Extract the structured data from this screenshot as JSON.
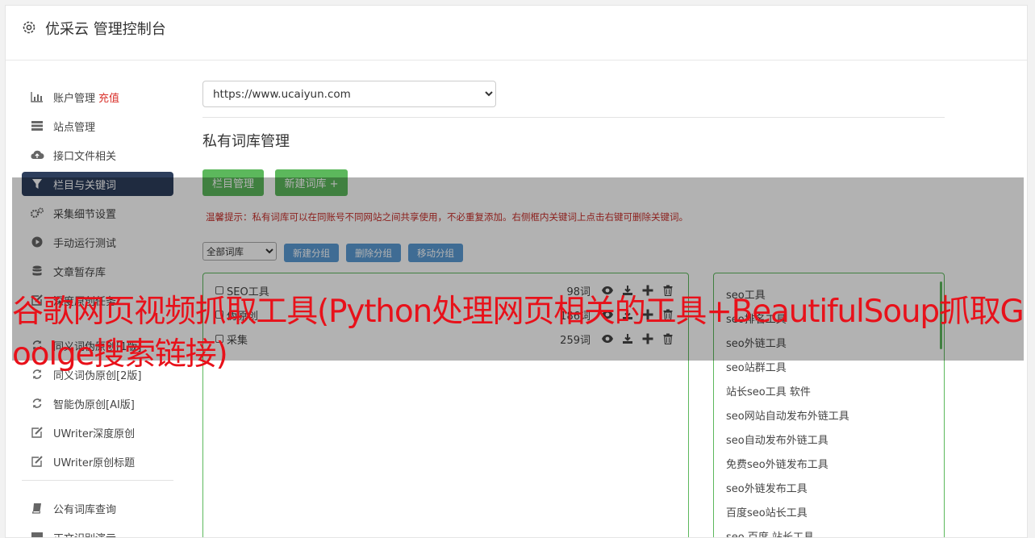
{
  "header": {
    "title": "优采云 管理控制台"
  },
  "sidebar": {
    "items": [
      {
        "label": "账户管理",
        "badge": "充值",
        "icon": "bar-chart-icon"
      },
      {
        "label": "站点管理",
        "icon": "server-icon"
      },
      {
        "label": "接口文件相关",
        "icon": "cloud-upload-icon"
      },
      {
        "label": "栏目与关键词",
        "icon": "filter-icon",
        "active": true
      },
      {
        "label": "采集细节设置",
        "icon": "gears-icon"
      },
      {
        "label": "手动运行测试",
        "icon": "play-circle-icon"
      },
      {
        "label": "文章暂存库",
        "icon": "database-icon"
      },
      {
        "label": "深度原创任务",
        "icon": "edit-icon"
      },
      {
        "label": "同义词伪原创[1版]",
        "icon": "refresh-icon"
      },
      {
        "label": "同义词伪原创[2版]",
        "icon": "refresh-icon"
      },
      {
        "label": "智能伪原创[AI版]",
        "icon": "refresh-icon"
      },
      {
        "label": "UWriter深度原创",
        "icon": "edit-icon"
      },
      {
        "label": "UWriter原创标题",
        "icon": "edit-icon"
      },
      {
        "label": "公有词库查询",
        "icon": "book-icon"
      },
      {
        "label": "正文识别演示",
        "icon": "monitor-icon"
      }
    ]
  },
  "main": {
    "site_select": {
      "value": "https://www.ucaiyun.com"
    },
    "page_title": "私有词库管理",
    "buttons": {
      "column_manage": "栏目管理",
      "new_library": "新建词库 +"
    },
    "tip": "温馨提示：私有词库可以在同账号不同网站之间共享使用，不必重复添加。右侧框内关键词上点击右键可删除关键词。",
    "group_select": {
      "value": "全部词库"
    },
    "group_buttons": {
      "new_group": "新建分组",
      "delete_group": "删除分组",
      "move_group": "移动分组"
    },
    "libraries": [
      {
        "name": "SEO工具",
        "count": "98词"
      },
      {
        "name": "伪原创",
        "count": "186词"
      },
      {
        "name": "采集",
        "count": "259词"
      }
    ],
    "keywords": [
      "seo工具",
      "seo排名工具",
      "seo外链工具",
      "seo站群工具",
      "站长seo工具 软件",
      "seo网站自动发布外链工具",
      "seo自动发布外链工具",
      "免费seo外链发布工具",
      "seo外链发布工具",
      "百度seo站长工具",
      "seo 百度 站长工具"
    ]
  },
  "overlay_caption": "谷歌网页视频抓取工具(Python处理网页相关的工具+BeautifulSoup抓取Goolge搜索链接)",
  "colors": {
    "active_nav": "#2d3e5c",
    "green": "#5cb85c",
    "blue": "#5b9bd5",
    "red": "#d9302a"
  }
}
